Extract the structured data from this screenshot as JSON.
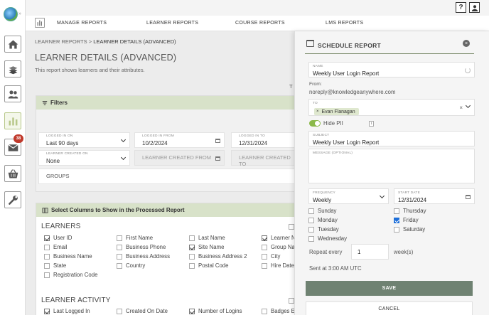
{
  "sidebar": {
    "collapse_glyph": "»",
    "notification_count": "38"
  },
  "topbar": {
    "help_label": "?",
    "user_icon": "user-icon"
  },
  "nav": {
    "items": [
      "MANAGE REPORTS",
      "LEARNER REPORTS",
      "COURSE REPORTS",
      "LMS REPORTS"
    ]
  },
  "breadcrumb": {
    "parent": "LEARNER REPORTS",
    "separator": ">",
    "current": "LEARNER DETAILS (ADVANCED)"
  },
  "page": {
    "title": "LEARNER DETAILS (ADVANCED)",
    "subtitle": "This report shows learners and their attributes.",
    "clipped_text": "T"
  },
  "filters": {
    "title": "Filters",
    "logged_in_on": {
      "label": "LOGGED IN ON",
      "value": "Last 90 days"
    },
    "logged_in_from": {
      "label": "LOGGED IN FROM",
      "value": "10/2/2024"
    },
    "logged_in_to": {
      "label": "LOGGED IN TO",
      "value": "12/31/2024"
    },
    "learner_created_on": {
      "label": "LEARNER CREATED ON",
      "value": "None"
    },
    "learner_created_from": {
      "placeholder": "LEARNER CREATED FROM"
    },
    "learner_created_to": {
      "placeholder": "LEARNER CREATED TO"
    },
    "groups": {
      "placeholder": "GROUPS"
    }
  },
  "columns": {
    "title": "Select Columns to Show in the Processed Report",
    "learners_label": "LEARNERS",
    "learners": [
      {
        "label": "User ID",
        "checked": true
      },
      {
        "label": "First Name",
        "checked": false
      },
      {
        "label": "Last Name",
        "checked": false
      },
      {
        "label": "Learner N",
        "checked": true
      },
      {
        "label": "Email",
        "checked": false
      },
      {
        "label": "Business Phone",
        "checked": false
      },
      {
        "label": "Site Name",
        "checked": true
      },
      {
        "label": "Group Na",
        "checked": false
      },
      {
        "label": "Business Name",
        "checked": false
      },
      {
        "label": "Business Address",
        "checked": false
      },
      {
        "label": "Business Address 2",
        "checked": false
      },
      {
        "label": "City",
        "checked": false
      },
      {
        "label": "State",
        "checked": false
      },
      {
        "label": "Country",
        "checked": false
      },
      {
        "label": "Postal Code",
        "checked": false
      },
      {
        "label": "Hire Date",
        "checked": false
      },
      {
        "label": "Registration Code",
        "checked": false
      }
    ],
    "activity_label": "LEARNER ACTIVITY",
    "activity": [
      {
        "label": "Last Logged In",
        "checked": true
      },
      {
        "label": "Created On Date",
        "checked": false
      },
      {
        "label": "Number of Logins",
        "checked": true
      },
      {
        "label": "Badges Ea",
        "checked": false
      }
    ]
  },
  "schedule": {
    "title": "SCHEDULE REPORT",
    "close": "×",
    "name": {
      "label": "NAME",
      "value": "Weekly User Login Report"
    },
    "from_label": "From:",
    "from_value": "noreply@knowledgeanywhere.com",
    "to": {
      "label": "TO",
      "recipient": "Evan Flanagan",
      "remove": "×",
      "clear": "×"
    },
    "hide_pii": {
      "label": "Hide PII",
      "on": true,
      "info": "i"
    },
    "subject": {
      "label": "SUBJECT",
      "value": "Weekly User Login Report"
    },
    "message": {
      "label": "MESSAGE (OPTIONAL)",
      "value": ""
    },
    "frequency": {
      "label": "FREQUENCY",
      "value": "Weekly"
    },
    "start_date": {
      "label": "START DATE",
      "value": "12/31/2024"
    },
    "days": [
      {
        "label": "Sunday",
        "checked": false
      },
      {
        "label": "Thursday",
        "checked": false
      },
      {
        "label": "Monday",
        "checked": false
      },
      {
        "label": "Friday",
        "checked": true
      },
      {
        "label": "Tuesday",
        "checked": false
      },
      {
        "label": "Saturday",
        "checked": false
      },
      {
        "label": "Wednesday",
        "checked": false
      }
    ],
    "repeat": {
      "label": "Repeat every",
      "value": "1",
      "unit": "week(s)"
    },
    "sent_at": "Sent at 3:00 AM UTC",
    "save_label": "SAVE",
    "cancel_label": "CANCEL"
  }
}
